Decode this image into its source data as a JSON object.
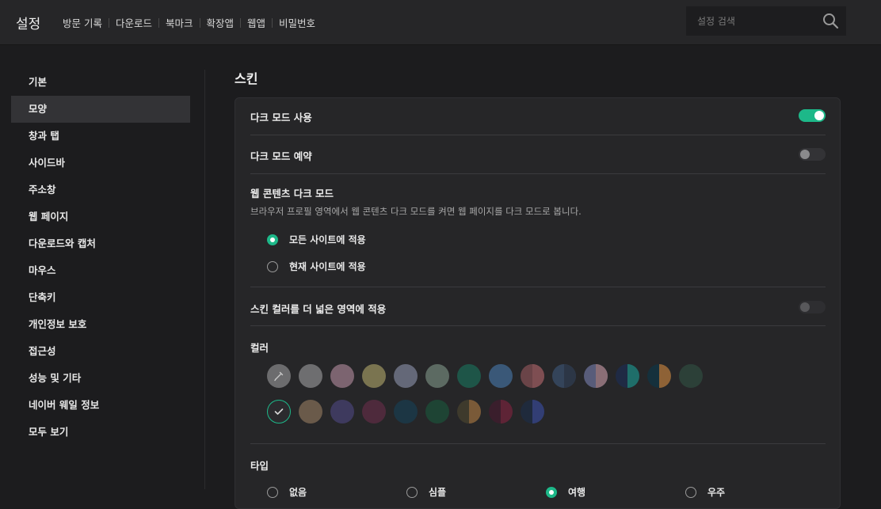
{
  "header": {
    "title": "설정",
    "nav": [
      "방문 기록",
      "다운로드",
      "북마크",
      "확장앱",
      "웹앱",
      "비밀번호"
    ],
    "search_placeholder": "설정 검색"
  },
  "sidebar": {
    "items": [
      "기본",
      "모양",
      "창과 탭",
      "사이드바",
      "주소창",
      "웹 페이지",
      "다운로드와 캡처",
      "마우스",
      "단축키",
      "개인정보 보호",
      "접근성",
      "성능 및 기타",
      "네이버 웨일 정보",
      "모두 보기"
    ],
    "active_index": 1
  },
  "skin": {
    "title": "스킨",
    "dark_mode": {
      "label": "다크 모드 사용",
      "enabled": true
    },
    "dark_schedule": {
      "label": "다크 모드 예약",
      "enabled": false
    },
    "web_dark": {
      "label": "웹 콘텐츠 다크 모드",
      "description": "브라우저 프로필 영역에서 웹 콘텐츠 다크 모드를 켜면 웹 페이지를 다크 모드로 봅니다.",
      "options": [
        "모든 사이트에 적용",
        "현재 사이트에 적용"
      ],
      "selected_index": 0
    },
    "wide_color": {
      "label": "스킨 컬러를 더 넓은 영역에 적용",
      "enabled": false
    },
    "color": {
      "label": "컬러",
      "row1": [
        {
          "a": "#6c6c6e",
          "b": null
        },
        {
          "a": "#6e6e70",
          "b": null
        },
        {
          "a": "#7c6470",
          "b": null
        },
        {
          "a": "#7a7450",
          "b": null
        },
        {
          "a": "#646878",
          "b": null
        },
        {
          "a": "#5c6a62",
          "b": null
        },
        {
          "a": "#1e5548",
          "b": null
        },
        {
          "a": "#3a5878",
          "b": null
        },
        {
          "a": "#6a4448",
          "b": "#7e4e52"
        },
        {
          "a": "#34445a",
          "b": "#2c3646"
        },
        {
          "a": "#585c7a",
          "b": "#8a6e76"
        },
        {
          "a": "#1f2a44",
          "b": "#1f6e6a"
        },
        {
          "a": "#15303c",
          "b": "#8e6236"
        },
        {
          "a": "#2c4038",
          "b": null
        }
      ],
      "row2": [
        {
          "a": "#2b2b2e",
          "b": null
        },
        {
          "a": "#6a5a4a",
          "b": null
        },
        {
          "a": "#3e3a5e",
          "b": null
        },
        {
          "a": "#4e2a3c",
          "b": null
        },
        {
          "a": "#1c3644",
          "b": null
        },
        {
          "a": "#1e4434",
          "b": null
        },
        {
          "a": "#3e3a2c",
          "b": "#7a5a38"
        },
        {
          "a": "#3a1e2c",
          "b": "#5e2436"
        },
        {
          "a": "#1f2a3c",
          "b": "#323e74"
        }
      ],
      "selected": "row2-0",
      "accent": "#1db889"
    },
    "type": {
      "label": "타입",
      "options": [
        "없음",
        "심플",
        "여행",
        "우주"
      ],
      "selected_index": 2
    }
  }
}
